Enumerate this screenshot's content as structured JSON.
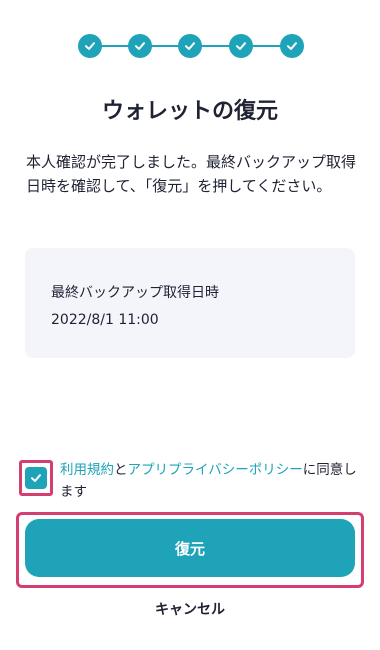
{
  "colors": {
    "accent": "#1ea3b8",
    "highlight": "#d63e72",
    "text": "#1f2233",
    "card_background": "#f4f4fb"
  },
  "stepper": {
    "total_steps": 5,
    "completed_steps": 5,
    "step_icon": "check-icon"
  },
  "title": "ウォレットの復元",
  "description": "本人確認が完了しました。最終バックアップ取得日時を確認して、「復元」を押してください。",
  "backup_card": {
    "label": "最終バックアップ取得日時",
    "value": "2022/8/1 11:00"
  },
  "consent": {
    "checked": true,
    "terms_link": "利用規約",
    "connector": "と",
    "privacy_link": "アプリプライバシーポリシー",
    "suffix": "に同意します"
  },
  "buttons": {
    "restore": "復元",
    "cancel": "キャンセル"
  }
}
